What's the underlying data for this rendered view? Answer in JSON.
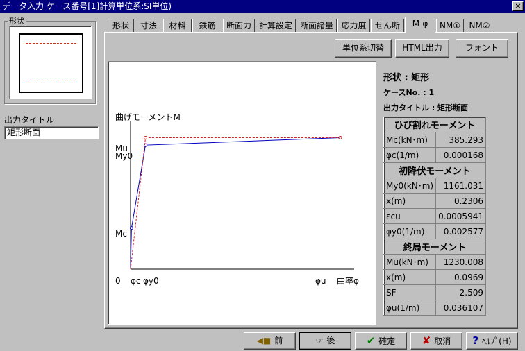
{
  "window": {
    "title": "データ入力  ケース番号[1]計算単位系:SI単位)",
    "close_glyph": "×"
  },
  "left": {
    "group_label": "形状",
    "output_title_label": "出力タイトル",
    "output_title_value": "矩形断面"
  },
  "tabs": [
    {
      "label": "形状"
    },
    {
      "label": "寸法"
    },
    {
      "label": "材料"
    },
    {
      "label": "鉄筋"
    },
    {
      "label": "断面力"
    },
    {
      "label": "計算設定"
    },
    {
      "label": "断面諸量"
    },
    {
      "label": "応力度"
    },
    {
      "label": "せん断"
    },
    {
      "label": "M-φ",
      "active": true
    },
    {
      "label": "NM①"
    },
    {
      "label": "NM②"
    }
  ],
  "toolbar": {
    "unit_switch": "単位系切替",
    "html_output": "HTML出力",
    "font": "フォント"
  },
  "chart_data": {
    "type": "line",
    "ylabel": "曲げモーメントM",
    "xlabel": "曲率φ",
    "origin_label": "0",
    "x_tick_labels": [
      "φc",
      "φy0",
      "φu"
    ],
    "y_tick_labels": [
      "Mc",
      "My0",
      "Mu"
    ],
    "series": [
      {
        "style": "solid",
        "color": "#0000c0",
        "points": [
          [
            0,
            0
          ],
          [
            0.000168,
            385.293
          ],
          [
            0.002577,
            1161.031
          ],
          [
            0.036107,
            1230.008
          ]
        ]
      },
      {
        "style": "dashed",
        "color": "#d02020",
        "points": [
          [
            0,
            0
          ],
          [
            0.002577,
            1230.008
          ],
          [
            0.036107,
            1230.008
          ]
        ]
      }
    ],
    "xlim": [
      0,
      0.0385
    ],
    "ylim": [
      0,
      1740
    ]
  },
  "info": {
    "shape": "形状 : 矩形",
    "case": "ケースNo. : 1",
    "output_title": "出力タイトル : 矩形断面"
  },
  "table": {
    "crack_header": "ひび割れモーメント",
    "mc_label": "Mc(kN･m)",
    "mc_value": "385.293",
    "phic_label": "φc(1/m)",
    "phic_value": "0.000168",
    "yield_header": "初降伏モーメント",
    "my0_label": "My0(kN･m)",
    "my0_value": "1161.031",
    "x1_label": "x(m)",
    "x1_value": "0.2306",
    "ecu_label": "εcu",
    "ecu_value": "0.0005941",
    "phiy0_label": "φy0(1/m)",
    "phiy0_value": "0.002577",
    "ultimate_header": "終局モーメント",
    "mu_label": "Mu(kN･m)",
    "mu_value": "1230.008",
    "x2_label": "x(m)",
    "x2_value": "0.0969",
    "sf_label": "SF",
    "sf_value": "2.509",
    "phiu_label": "φu(1/m)",
    "phiu_value": "0.036107"
  },
  "buttons": {
    "prev": "前",
    "next": "後",
    "ok": "確定",
    "cancel": "取消",
    "help": "ﾍﾙﾌﾟ(H)",
    "prev_icon": "◀■",
    "next_icon": "☞",
    "ok_icon": "✔",
    "cancel_icon": "✘",
    "help_icon": "?"
  },
  "colors": {
    "title_bar": "#000080",
    "face": "#c0c0c0",
    "curve": "#0000c0",
    "idealized": "#d02020"
  }
}
